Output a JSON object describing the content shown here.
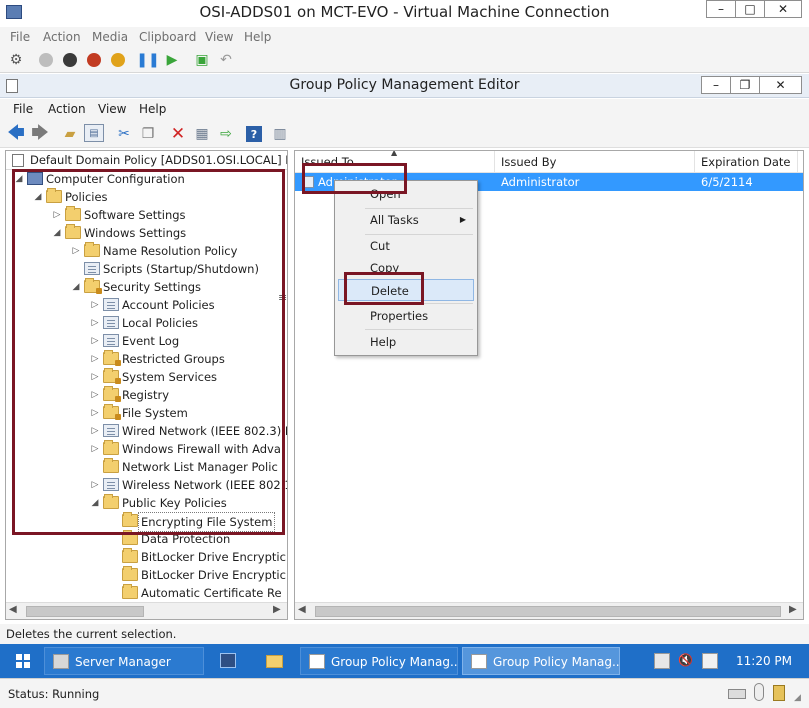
{
  "vm_window": {
    "title": "OSI-ADDS01 on MCT-EVO - Virtual Machine Connection",
    "menu": [
      "File",
      "Action",
      "Media",
      "Clipboard",
      "View",
      "Help"
    ],
    "controls": {
      "minimize": "–",
      "maximize": "□",
      "close": "✕"
    }
  },
  "editor_window": {
    "title": "Group Policy Management Editor",
    "menu": [
      "File",
      "Action",
      "View",
      "Help"
    ],
    "controls": {
      "minimize": "–",
      "restore": "❐",
      "close": "✕"
    }
  },
  "tree": {
    "header": "Default Domain Policy [ADDS01.OSI.LOCAL] P",
    "items": [
      {
        "label": "Computer Configuration",
        "expander": "◢"
      },
      {
        "label": "Policies",
        "expander": "◢"
      },
      {
        "label": "Software Settings",
        "expander": "▷"
      },
      {
        "label": "Windows Settings",
        "expander": "◢"
      },
      {
        "label": "Name Resolution Policy",
        "expander": "▷"
      },
      {
        "label": "Scripts (Startup/Shutdown)",
        "expander": ""
      },
      {
        "label": "Security Settings",
        "expander": "◢"
      },
      {
        "label": "Account Policies",
        "expander": "▷"
      },
      {
        "label": "Local Policies",
        "expander": "▷"
      },
      {
        "label": "Event Log",
        "expander": "▷"
      },
      {
        "label": "Restricted Groups",
        "expander": "▷"
      },
      {
        "label": "System Services",
        "expander": "▷"
      },
      {
        "label": "Registry",
        "expander": "▷"
      },
      {
        "label": "File System",
        "expander": "▷"
      },
      {
        "label": "Wired Network (IEEE 802.3) I",
        "expander": "▷"
      },
      {
        "label": "Windows Firewall with Adva",
        "expander": "▷"
      },
      {
        "label": "Network List Manager Polic",
        "expander": ""
      },
      {
        "label": "Wireless Network (IEEE 802.1",
        "expander": "▷"
      },
      {
        "label": "Public Key Policies",
        "expander": "◢"
      },
      {
        "label": "Encrypting File System",
        "expander": ""
      },
      {
        "label": "Data Protection",
        "expander": ""
      },
      {
        "label": "BitLocker Drive Encryptic",
        "expander": ""
      },
      {
        "label": "BitLocker Drive Encryptic",
        "expander": ""
      },
      {
        "label": "Automatic Certificate Re",
        "expander": ""
      }
    ]
  },
  "list": {
    "columns": [
      "Issued To",
      "Issued By",
      "Expiration Date"
    ],
    "row": {
      "issued_to": "Administrator",
      "issued_by": "Administrator",
      "expiration": "6/5/2114"
    }
  },
  "context_menu": {
    "items": [
      "Open",
      "All Tasks",
      "Cut",
      "Copy",
      "Delete",
      "Properties",
      "Help"
    ],
    "submenu_arrow": "▶",
    "highlighted": "Delete"
  },
  "status_line": "Deletes the current selection.",
  "taskbar": {
    "buttons": [
      "Server Manager",
      "Group Policy Manag...",
      "Group Policy Manag..."
    ],
    "clock": "11:20 PM"
  },
  "vm_status": "Status: Running",
  "colors": {
    "selection": "#3399ff",
    "taskbar": "#1f6fc8",
    "annotation": "#7a1624"
  }
}
